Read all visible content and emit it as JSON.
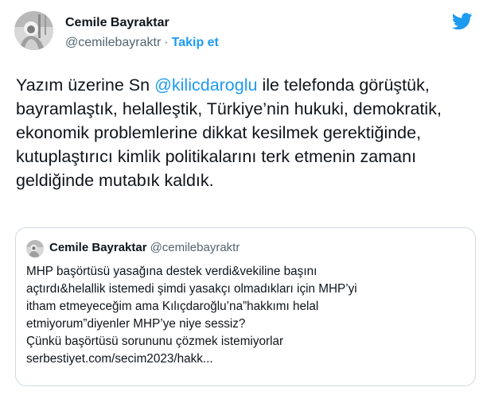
{
  "author": {
    "name": "Cemile Bayraktar",
    "handle": "@cemilebayraktr",
    "separator": "·",
    "follow_label": "Takip et"
  },
  "tweet": {
    "text_before": "Yazım üzerine Sn ",
    "mention": "@kilicdaroglu",
    "text_after": " ile telefonda görüştük, bayramlaştık, helalleştik, Türkiye’nin hukuki, demokratik, ekonomik problemlerine dikkat kesilmek gerektiğinde, kutuplaştırıcı kimlik politikalarını terk etmenin zamanı geldiğinde mutabık kaldık."
  },
  "quote": {
    "name": "Cemile Bayraktar",
    "handle": "@cemilebayraktr",
    "lines": [
      "MHP başörtüsü yasağına destek verdi&vekiline başını",
      "açtırdı&helallik istemedi şimdi yasakçı olmadıkları için MHP’yi",
      "itham etmeyeceğim ama Kılıçdaroğlu’na”hakkımı helal",
      "etmiyorum”diyenler MHP’ye niye sessiz?",
      "Çünkü başörtüsü sorununu çözmek istemiyorlar",
      "serbestiyet.com/secim2023/hakk..."
    ]
  },
  "icons": {
    "brand": "twitter-bird-icon",
    "brand_color": "#1d9bf0"
  },
  "colors": {
    "link": "#1d9bf0",
    "text": "#0f1419",
    "secondary": "#536471",
    "border": "#cfd9de"
  }
}
